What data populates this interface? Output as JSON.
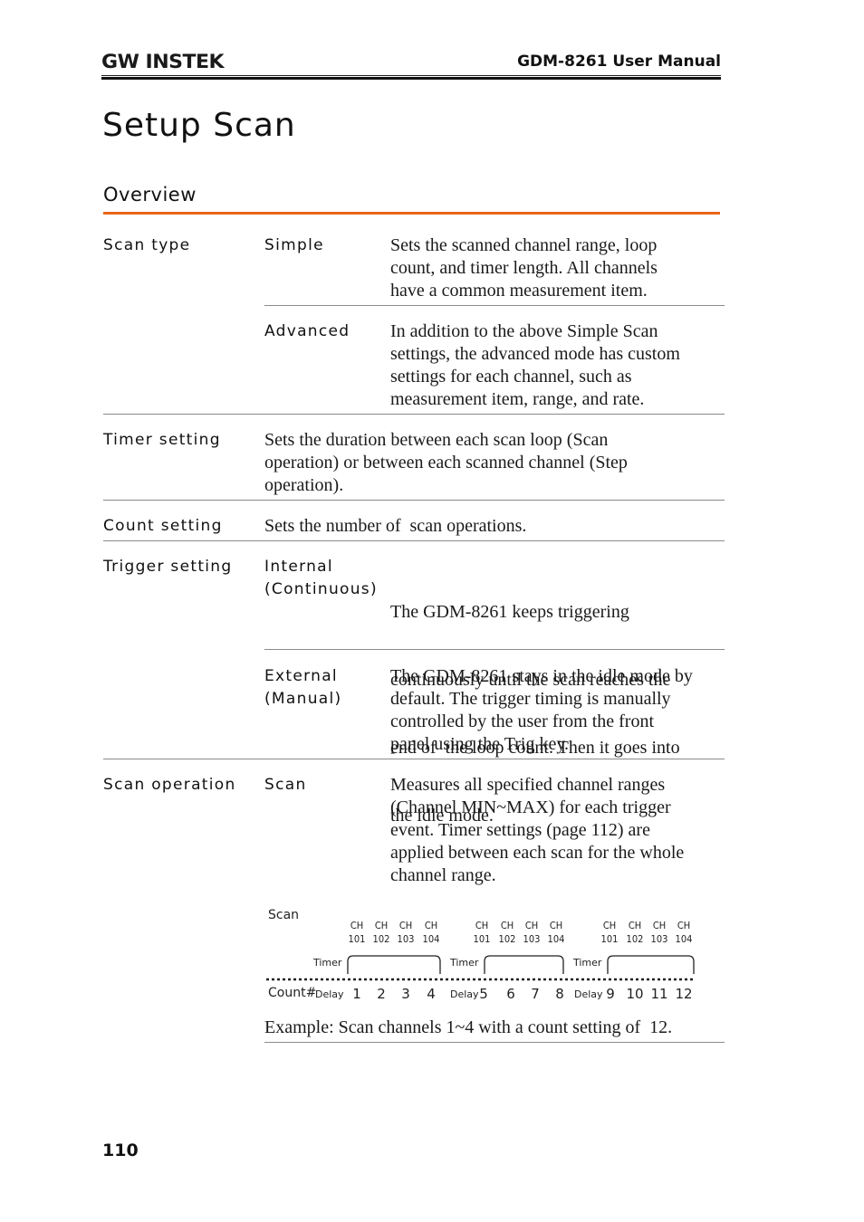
{
  "header": {
    "logo": "GW INSTEK",
    "manual_title": "GDM-8261 User Manual"
  },
  "page_title": "Setup Scan",
  "section_title": "Overview",
  "rows": {
    "scan_type": {
      "label": "Scan type",
      "simple": {
        "label": "Simple",
        "text": [
          "Sets the scanned channel range, loop",
          "count, and timer length. All channels",
          "have a common measurement item."
        ]
      },
      "advanced": {
        "label": "Advanced",
        "text": [
          "In addition to the above Simple Scan",
          "settings, the advanced mode has custom",
          "settings for each channel, such as",
          "measurement item, range, and rate."
        ]
      }
    },
    "timer_setting": {
      "label": "Timer setting",
      "text": [
        "Sets the duration between each scan loop (Scan",
        "operation) or between each scanned channel (Step",
        "operation)."
      ]
    },
    "count_setting": {
      "label": "Count setting",
      "text": [
        "Sets the number of  scan operations."
      ]
    },
    "trigger_setting": {
      "label": "Trigger setting",
      "internal": {
        "label": [
          "Internal",
          "(Continuous)"
        ],
        "text": [
          "The GDM-8261 keeps triggering",
          "continuously until the scan reaches the",
          "end of  the loop count. Then it goes into",
          "the idle mode."
        ]
      },
      "external": {
        "label": [
          "External",
          "(Manual)"
        ],
        "text": [
          "The GDM-8261 stays in the idle mode by",
          "default. The trigger timing is manually",
          "controlled by the user from the front",
          "panel using the Trig key."
        ]
      }
    },
    "scan_operation": {
      "label": "Scan operation",
      "scan": {
        "label": "Scan",
        "text": [
          "Measures all specified channel ranges",
          "(Channel MIN~MAX) for each trigger",
          "event. Timer settings (page 112) are",
          "applied between each scan for the whole",
          "channel range."
        ]
      }
    }
  },
  "diagram": {
    "title": "Scan",
    "count_label": "Count#",
    "timer_label": "Timer",
    "delay_label": "Delay",
    "channel_prefix": "CH",
    "channels": [
      "101",
      "102",
      "103",
      "104"
    ],
    "groups": [
      {
        "counts": [
          "1",
          "2",
          "3",
          "4"
        ]
      },
      {
        "counts": [
          "5",
          "6",
          "7",
          "8"
        ]
      },
      {
        "counts": [
          "9",
          "10",
          "11",
          "12"
        ]
      }
    ],
    "caption": "Example: Scan channels 1~4 with a count setting of  12."
  },
  "page_number": "110"
}
